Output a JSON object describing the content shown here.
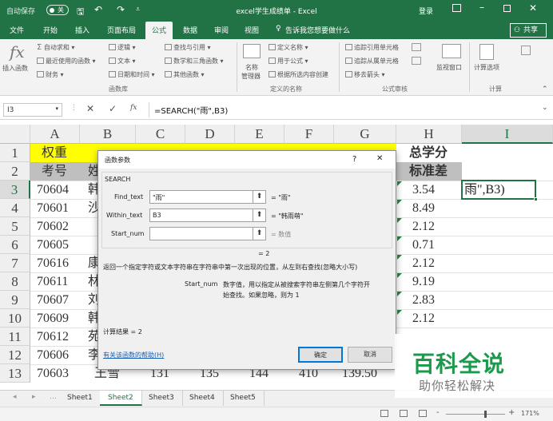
{
  "titlebar": {
    "autosave": "自动保存",
    "autosave_state": "关",
    "title": "excel学生成绩单 - Excel",
    "login": "登录"
  },
  "tabs": [
    "文件",
    "开始",
    "插入",
    "页面布局",
    "公式",
    "数据",
    "审阅",
    "视图"
  ],
  "active_tab": "公式",
  "tell_me": "告诉我您想要做什么",
  "share": "共享",
  "ribbon": {
    "insert_function": "插入函数",
    "autosum": "自动求和",
    "recent": "最近使用的函数",
    "financial": "财务",
    "logical": "逻辑",
    "text": "文本",
    "datetime": "日期和时间",
    "lookup": "查找与引用",
    "math": "数学和三角函数",
    "other": "其他函数",
    "group_library": "函数库",
    "name_manager_1": "名称",
    "name_manager_2": "管理器",
    "define_name": "定义名称",
    "use_in_formula": "用于公式",
    "create_from_sel": "根据所选内容创建",
    "group_names": "定义的名称",
    "trace_precedents": "追踪引用单元格",
    "trace_dependents": "追踪从属单元格",
    "remove_arrows": "移去箭头",
    "group_audit": "公式审核",
    "watch_window": "监视窗口",
    "calc_options": "计算选项",
    "group_calc": "计算"
  },
  "formula_bar": {
    "name_box": "I3",
    "formula": "=SEARCH(\"雨\",B3)"
  },
  "columns": [
    "A",
    "B",
    "C",
    "D",
    "E",
    "F",
    "G",
    "H",
    "I"
  ],
  "rows": [
    "1",
    "2",
    "3",
    "4",
    "5",
    "6",
    "7",
    "8",
    "9",
    "10",
    "11",
    "12",
    "13"
  ],
  "header_row1": {
    "a": "权重",
    "h": "总学分"
  },
  "header_row2": {
    "a": "考号",
    "b": "姓",
    "h": "标准差"
  },
  "data_a": [
    "70604",
    "70601",
    "70602",
    "70605",
    "70616",
    "70611",
    "70607",
    "70609",
    "70612",
    "70606",
    "70603"
  ],
  "data_b": [
    "韩",
    "沙",
    "",
    "",
    "康",
    "林",
    "刘",
    "韩",
    "苑",
    "李",
    "王雪"
  ],
  "data_h": [
    "3.54",
    "8.49",
    "2.12",
    "0.71",
    "2.12",
    "9.19",
    "2.83",
    "2.12",
    "",
    "",
    ""
  ],
  "row13": {
    "c": "131",
    "d": "135",
    "e": "144",
    "f": "410",
    "g": "139.50"
  },
  "cell_i3_overflow": "雨\",B3)",
  "dialog": {
    "title": "函数参数",
    "help": "?",
    "close": "✕",
    "func_name": "SEARCH",
    "args": [
      {
        "label": "Find_text",
        "value": "\"雨\"",
        "result": "= \"雨\""
      },
      {
        "label": "Within_text",
        "value": "B3",
        "result": "= \"韩雨萌\""
      },
      {
        "label": "Start_num",
        "value": "",
        "result": "= 数值"
      }
    ],
    "func_result": "= 2",
    "description": "返回一个指定字符或文本字符串在字符串中第一次出现的位置，从左到右查找(忽略大小写)",
    "arg_name": "Start_num",
    "arg_desc_1": "数字值，用以指定从被搜索字符串左侧第几个字符开",
    "arg_desc_2": "始查找。如果忽略，则为 1",
    "calc_result": "计算结果 =   2",
    "help_link": "有关该函数的帮助(H)",
    "ok": "确定",
    "cancel": "取消"
  },
  "sheets": [
    "Sheet1",
    "Sheet2",
    "Sheet3",
    "Sheet4",
    "Sheet5"
  ],
  "active_sheet": "Sheet2",
  "status": {
    "zoom": "171%",
    "plus": "+",
    "minus": "-"
  },
  "watermark": {
    "line1": "百科全说",
    "line2": "助你轻松解决"
  },
  "colors": {
    "excel_green": "#217346",
    "header_yellow": "#ffff00",
    "selected_border": "#217346"
  }
}
